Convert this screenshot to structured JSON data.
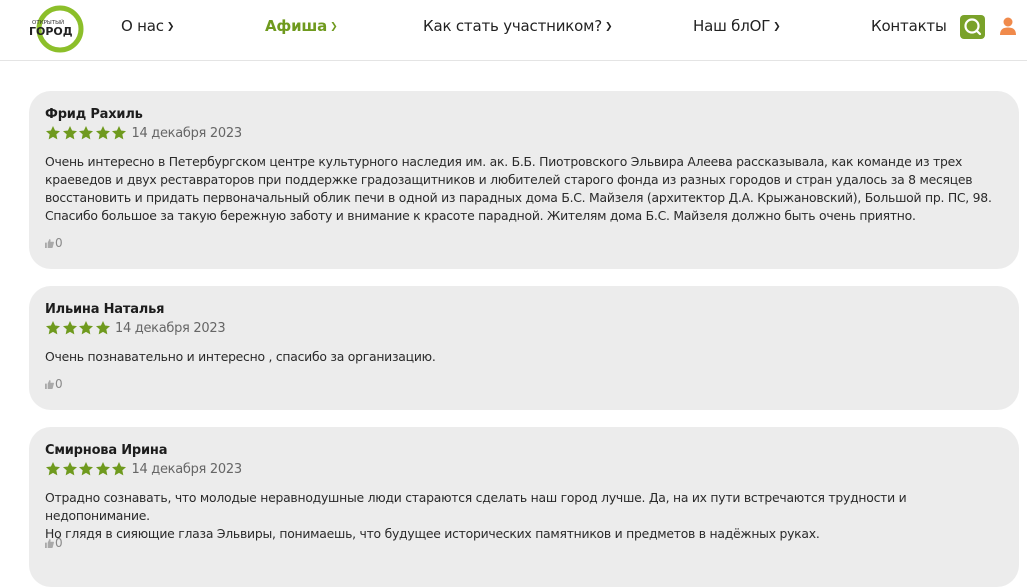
{
  "header": {
    "logo": {
      "line1": "ОТКРЫТЫЙ",
      "line2": "ГОРОД"
    },
    "nav": [
      {
        "label": "О нас",
        "active": false
      },
      {
        "label": "Афиша",
        "active": true
      },
      {
        "label": "Как стать участником?",
        "active": false
      },
      {
        "label": "Наш блОГ",
        "active": false
      },
      {
        "label": "Контакты",
        "active": false
      }
    ],
    "icons": {
      "search": "search-icon",
      "user": "user-icon"
    },
    "colors": {
      "accent": "#7aa22a",
      "user_icon": "#f08a4b"
    }
  },
  "reviews": [
    {
      "author": "Фрид Рахиль",
      "rating": 5,
      "date": "14 декабря 2023",
      "lines": [
        "Очень интересно в Петербургском центре культурного наследия им. ак. Б.Б. Пиотровского Эльвира Алеева рассказывала, как команде из трех",
        "краеведов и двух реставраторов при поддержке градозащитников и любителей старого фонда из разных городов и стран удалось за 8 месяцев",
        "восстановить и придать первоначальный облик печи в одной из парадных дома Б.С. Майзеля (архитектор Д.А. Крыжановский), Большой пр. ПС, 98.",
        "Спасибо большое за такую бережную заботу и внимание к красоте парадной. Жителям дома Б.С. Майзеля должно быть очень приятно."
      ],
      "likes": "0"
    },
    {
      "author": "Ильина Наталья",
      "rating": 4,
      "date": "14 декабря 2023",
      "lines": [
        "Очень познавательно и интересно , спасибо за организацию."
      ],
      "likes": "0"
    },
    {
      "author": "Смирнова Ирина",
      "rating": 5,
      "date": "14 декабря 2023",
      "lines": [
        "Отрадно сознавать, что молодые неравнодушные люди стараются сделать наш город лучше. Да, на их пути встречаются трудности и недопонимание.",
        "Но глядя в сияющие глаза Эльвиры, понимаешь, что будущее исторических памятников и предметов в надёжных руках."
      ],
      "likes": "0"
    }
  ],
  "colors": {
    "star": "#6f9a1e",
    "card_bg": "#ececec"
  }
}
